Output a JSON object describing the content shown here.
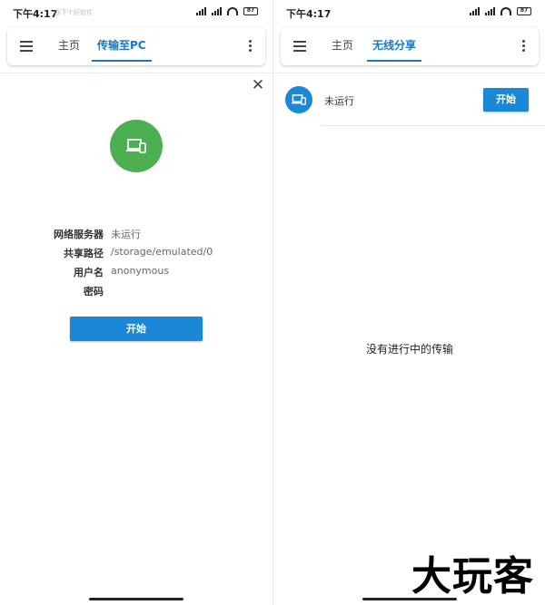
{
  "left": {
    "status": {
      "time": "下午4:17",
      "watermark": "@下个好软件",
      "battery": "87"
    },
    "tabs": {
      "home": "主页",
      "active": "传输至PC"
    },
    "icons": {
      "menu": "menu-icon",
      "more": "more-vert-icon",
      "close": "close-icon",
      "device": "devices-icon"
    },
    "info": [
      {
        "label": "网络服务器",
        "value": "未运行"
      },
      {
        "label": "共享路径",
        "value": "/storage/emulated/0"
      },
      {
        "label": "用户名",
        "value": "anonymous"
      },
      {
        "label": "密码",
        "value": ""
      }
    ],
    "start_label": "开始"
  },
  "right": {
    "status": {
      "time": "下午4:17",
      "battery": "87"
    },
    "tabs": {
      "home": "主页",
      "active": "无线分享"
    },
    "status_text": "未运行",
    "start_label": "开始",
    "empty_text": "没有进行中的传输"
  },
  "watermark_logo": "大玩客",
  "colors": {
    "accent": "#1a88d6",
    "green": "#4caf50"
  }
}
